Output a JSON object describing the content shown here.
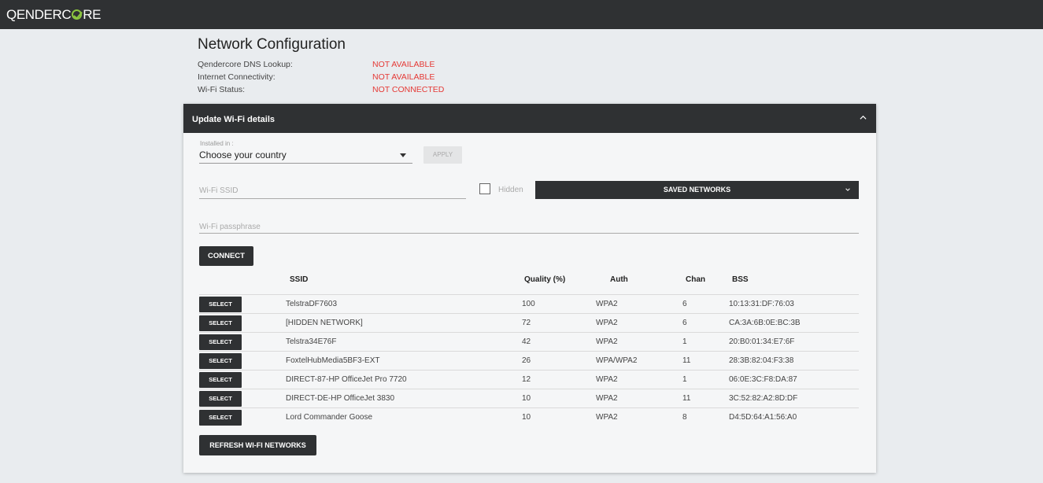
{
  "app": {
    "logo_pre": "QENDERC",
    "logo_post": "RE"
  },
  "status": {
    "title": "Network Configuration",
    "rows": [
      {
        "label": "Qendercore DNS Lookup:",
        "value": "NOT AVAILABLE"
      },
      {
        "label": "Internet Connectivity:",
        "value": "NOT AVAILABLE"
      },
      {
        "label": "Wi-Fi Status:",
        "value": "NOT CONNECTED"
      }
    ]
  },
  "wifi": {
    "header": "Update Wi-Fi details",
    "installed_label": "Installed in :",
    "country_value": "Choose your country",
    "apply_label": "APPLY",
    "ssid_placeholder": "Wi-Fi SSID",
    "hidden_label": "Hidden",
    "saved_networks_label": "SAVED NETWORKS",
    "pass_placeholder": "Wi-Fi passphrase",
    "connect_label": "CONNECT",
    "refresh_label": "REFRESH WI-FI NETWORKS",
    "select_label": "SELECT",
    "columns": {
      "ssid": "SSID",
      "quality": "Quality (%)",
      "auth": "Auth",
      "chan": "Chan",
      "bss": "BSS"
    },
    "networks": [
      {
        "ssid": "TelstraDF7603",
        "quality": "100",
        "auth": "WPA2",
        "chan": "6",
        "bss": "10:13:31:DF:76:03"
      },
      {
        "ssid": "[HIDDEN NETWORK]",
        "quality": "72",
        "auth": "WPA2",
        "chan": "6",
        "bss": "CA:3A:6B:0E:BC:3B"
      },
      {
        "ssid": "Telstra34E76F",
        "quality": "42",
        "auth": "WPA2",
        "chan": "1",
        "bss": "20:B0:01:34:E7:6F"
      },
      {
        "ssid": "FoxtelHubMedia5BF3-EXT",
        "quality": "26",
        "auth": "WPA/WPA2",
        "chan": "11",
        "bss": "28:3B:82:04:F3:38"
      },
      {
        "ssid": "DIRECT-87-HP OfficeJet Pro 7720",
        "quality": "12",
        "auth": "WPA2",
        "chan": "1",
        "bss": "06:0E:3C:F8:DA:87"
      },
      {
        "ssid": "DIRECT-DE-HP OfficeJet 3830",
        "quality": "10",
        "auth": "WPA2",
        "chan": "11",
        "bss": "3C:52:82:A2:8D:DF"
      },
      {
        "ssid": "Lord Commander Goose",
        "quality": "10",
        "auth": "WPA2",
        "chan": "8",
        "bss": "D4:5D:64:A1:56:A0"
      }
    ]
  }
}
